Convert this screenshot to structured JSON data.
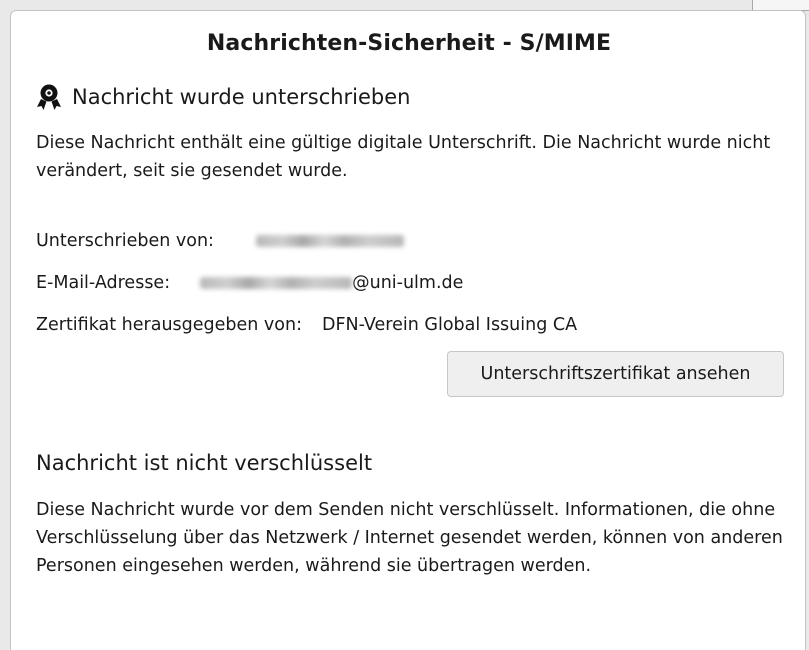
{
  "dialog": {
    "title": "Nachrichten-Sicherheit - S/MIME"
  },
  "signature": {
    "icon": "seal-icon",
    "heading": "Nachricht wurde unterschrieben",
    "description": "Diese Nachricht enthält eine gültige digitale Unterschrift. Die Nachricht wurde nicht verändert, seit sie gesendet wurde.",
    "signed_by_label": "Unterschrieben von:",
    "email_label": "E-Mail-Adresse:",
    "email_domain": "@uni-ulm.de",
    "issuer_label": "Zertifikat herausgegeben von:",
    "issuer_value": "DFN-Verein Global Issuing CA",
    "view_certificate_label": "Unterschriftszertifikat ansehen"
  },
  "encryption": {
    "heading": "Nachricht ist nicht verschlüsselt",
    "description": "Diese Nachricht wurde vor dem Senden nicht verschlüsselt. Informationen, die ohne Verschlüsselung über das Netzwerk / Internet gesendet werden, können von anderen Personen eingesehen werden, während sie übertragen werden."
  },
  "colors": {
    "panel_background": "#ffffff",
    "window_background": "#e9e9e9",
    "button_background": "#efefef",
    "text": "#1a1a1a"
  }
}
